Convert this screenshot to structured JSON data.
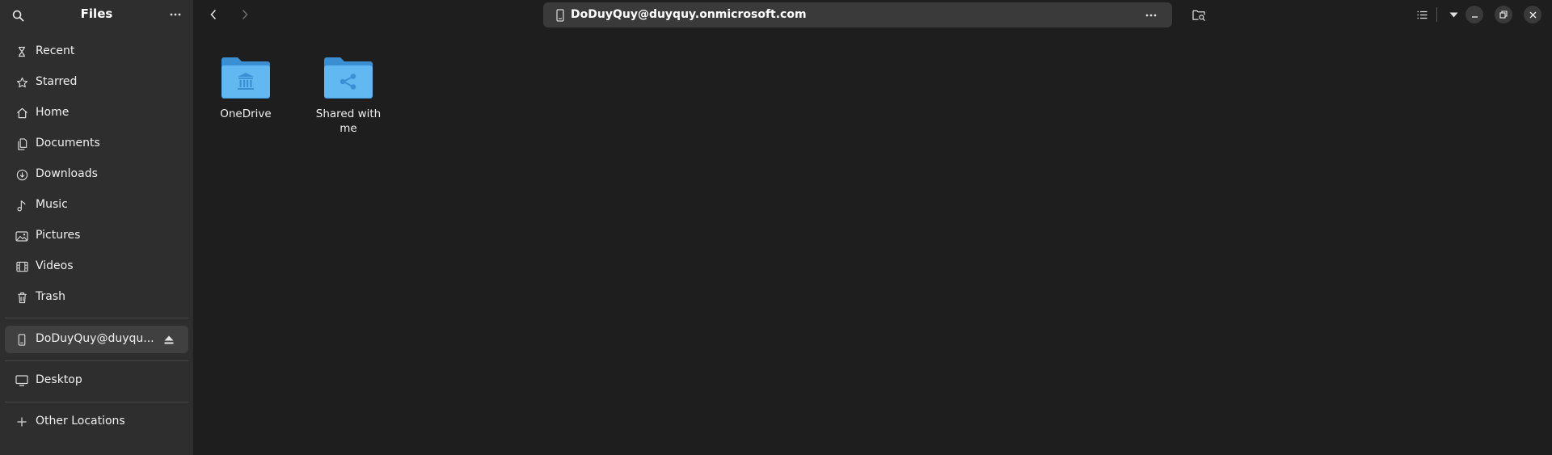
{
  "sidebar": {
    "title": "Files",
    "places": [
      {
        "label": "Recent",
        "icon": "clock-icon"
      },
      {
        "label": "Starred",
        "icon": "star-icon"
      },
      {
        "label": "Home",
        "icon": "home-icon"
      },
      {
        "label": "Documents",
        "icon": "document-icon"
      },
      {
        "label": "Downloads",
        "icon": "download-icon"
      },
      {
        "label": "Music",
        "icon": "music-icon"
      },
      {
        "label": "Pictures",
        "icon": "picture-icon"
      },
      {
        "label": "Videos",
        "icon": "video-icon"
      },
      {
        "label": "Trash",
        "icon": "trash-icon"
      }
    ],
    "mount": {
      "label": "DoDuyQuy@duyqu...",
      "icon": "drive-icon",
      "eject_icon": "eject-icon"
    },
    "bookmarks": [
      {
        "label": "Desktop",
        "icon": "desktop-icon"
      }
    ],
    "other_locations": {
      "label": "Other Locations",
      "icon": "plus-icon"
    }
  },
  "header": {
    "path": "DoDuyQuy@duyquy.onmicrosoft.com",
    "path_menu": "···"
  },
  "files": [
    {
      "name": "OneDrive",
      "icon": "folder-library-icon"
    },
    {
      "name": "Shared with me",
      "icon": "folder-share-icon"
    }
  ],
  "colors": {
    "folder_front": "#62b8f0",
    "folder_back": "#3a8fd3",
    "sidebar_bg": "#2e2e2e",
    "content_bg": "#1e1e1e"
  }
}
